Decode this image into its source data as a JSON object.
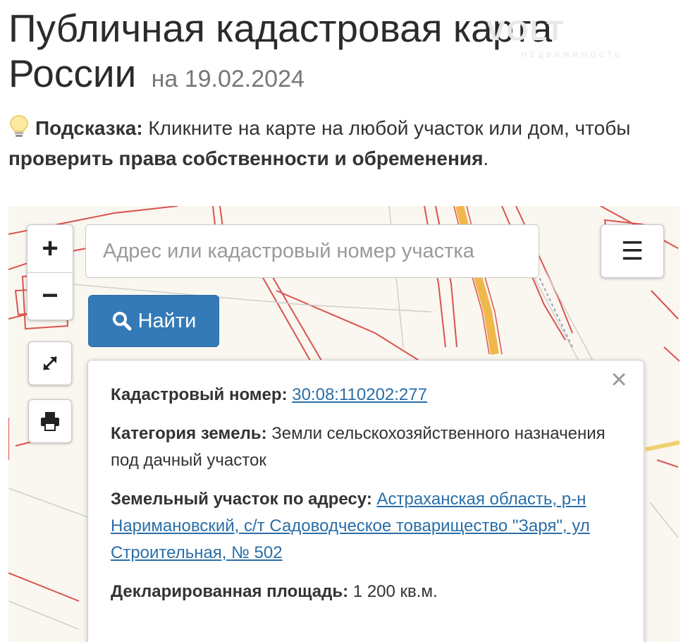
{
  "header": {
    "title": "Публичная кадастровая карта России",
    "date_label": "на 19.02.2024"
  },
  "watermark": {
    "text": "VOLT",
    "sub": "НЕДВИЖИМОСТЬ"
  },
  "hint": {
    "icon": "lightbulb-icon",
    "label": "Подсказка:",
    "text1": "Кликните на карте на любой участок или дом, чтобы",
    "bold": "проверить права собственности и обременения",
    "end": "."
  },
  "controls": {
    "zoom_in": "+",
    "zoom_out": "−",
    "menu": "☰",
    "fullscreen_icon": "expand-icon",
    "print_icon": "printer-icon"
  },
  "search": {
    "placeholder": "Адрес или кадастровый номер участка",
    "value": "",
    "button_label": "Найти"
  },
  "popup": {
    "close": "×",
    "cadastral_label": "Кадастровый номер:",
    "cadastral_value": "30:08:110202:277",
    "category_label": "Категория земель:",
    "category_value": "Земли сельскохозяйственного назначения",
    "usage": "под дачный участок",
    "address_label": "Земельный участок по адресу:",
    "address_value": "Астраханская область, р-н Наримановский, с/т Садоводческое товарищество \"Заря\", ул Строительная, № 502",
    "area_label": "Декларированная площадь:",
    "area_value": "1 200 кв.м."
  },
  "colors": {
    "parcel_line": "#d9534f",
    "road": "#f0b84a",
    "button": "#337ab7",
    "link": "#2a6ea8"
  }
}
